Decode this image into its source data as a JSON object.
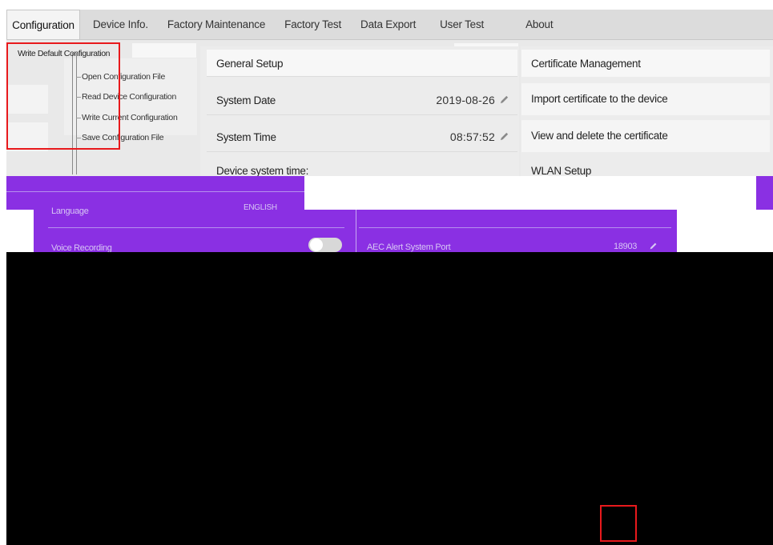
{
  "tabs": [
    {
      "label": "Configuration",
      "active": true
    },
    {
      "label": "Device Info.",
      "active": false
    },
    {
      "label": "Factory Maintenance",
      "active": false
    },
    {
      "label": "Factory Test",
      "active": false
    },
    {
      "label": "Data Export",
      "active": false
    },
    {
      "label": "User Test",
      "active": false
    },
    {
      "label": "About",
      "active": false
    }
  ],
  "config_menu": {
    "items": [
      "Write Default Configuration",
      "Open Configuration File",
      "Read Device Configuration",
      "Write Current Configuration",
      "Save Configuration File"
    ]
  },
  "general_setup": {
    "title": "General Setup",
    "system_date_label": "System Date",
    "system_date_value": "2019-08-26",
    "system_time_label": "System Time",
    "system_time_value": "08:57:52",
    "device_time_label": "Device system time:"
  },
  "certificate": {
    "title": "Certificate Management",
    "import_label": "Import certificate to the device",
    "view_label": "View and delete the certificate"
  },
  "wlan": {
    "title": "WLAN Setup"
  },
  "overlay": {
    "language_label": "Language",
    "voice_recording_label": "Voice Recording",
    "aec_alert_label": "AEC Alert System Port",
    "aec_alert_value": "18903",
    "english_value": "ENGLISH"
  },
  "colors": {
    "accent_purple": "#8a30e3",
    "highlight_red": "#e8191c"
  }
}
